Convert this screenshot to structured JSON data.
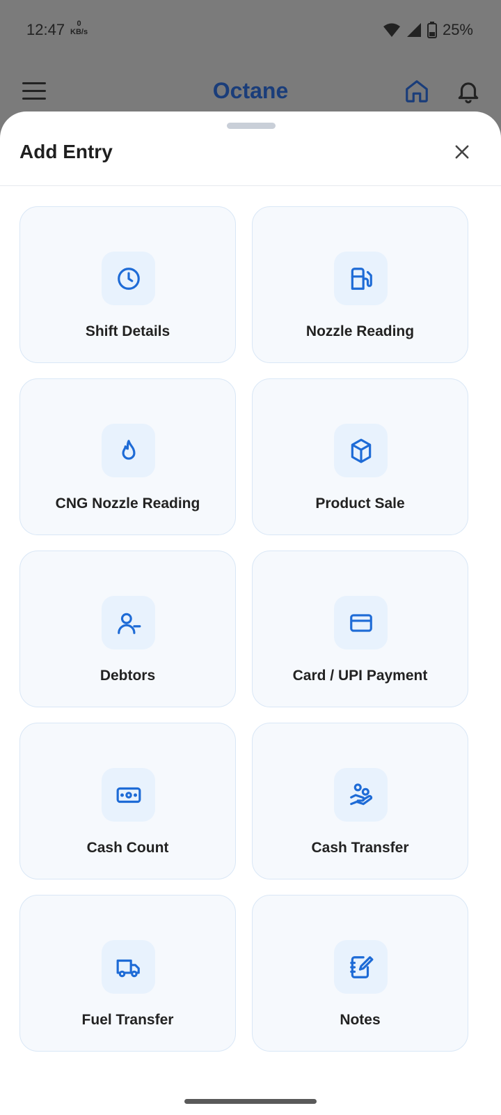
{
  "status": {
    "time": "12:47",
    "net_value": "0",
    "net_unit": "KB/s",
    "battery": "25%"
  },
  "appbar": {
    "title": "Octane"
  },
  "sheet": {
    "title": "Add Entry"
  },
  "tiles": [
    {
      "label": "Shift Details",
      "icon": "clock-icon"
    },
    {
      "label": "Nozzle Reading",
      "icon": "fuel-pump-icon"
    },
    {
      "label": "CNG Nozzle Reading",
      "icon": "flame-icon"
    },
    {
      "label": "Product Sale",
      "icon": "box-icon"
    },
    {
      "label": "Debtors",
      "icon": "user-minus-icon"
    },
    {
      "label": "Card / UPI Payment",
      "icon": "credit-card-icon"
    },
    {
      "label": "Cash Count",
      "icon": "banknote-icon"
    },
    {
      "label": "Cash Transfer",
      "icon": "hand-coins-icon"
    },
    {
      "label": "Fuel Transfer",
      "icon": "truck-icon"
    },
    {
      "label": "Notes",
      "icon": "notebook-pen-icon"
    }
  ],
  "colors": {
    "accent": "#1e6bd6",
    "tile_bg": "#f6f9fd",
    "tile_border": "#d9e7f6",
    "title_brand": "#1a3d7a"
  }
}
